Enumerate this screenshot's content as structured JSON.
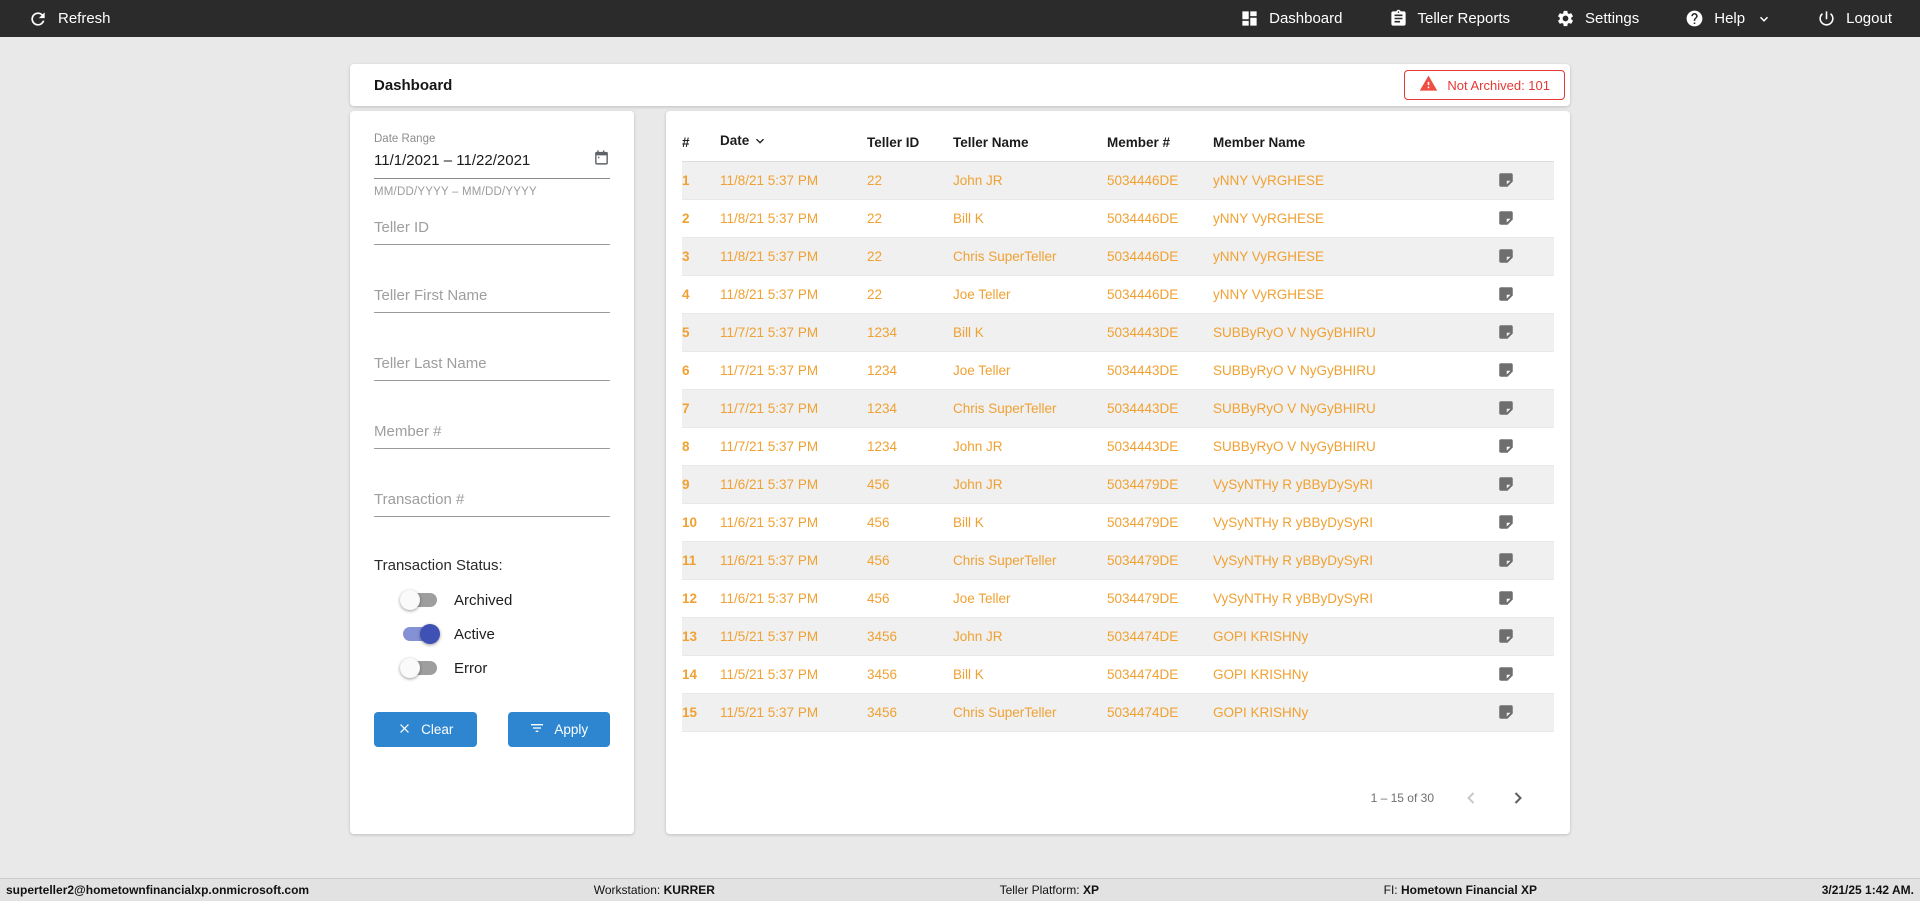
{
  "topbar": {
    "refresh_label": "Refresh",
    "nav": [
      {
        "label": "Dashboard",
        "icon": "dashboard-icon"
      },
      {
        "label": "Teller Reports",
        "icon": "clipboard-icon"
      },
      {
        "label": "Settings",
        "icon": "gear-icon"
      },
      {
        "label": "Help",
        "icon": "help-icon"
      },
      {
        "label": "Logout",
        "icon": "power-icon"
      }
    ]
  },
  "header": {
    "title": "Dashboard",
    "not_archived_badge": "Not Archived: 101"
  },
  "filters": {
    "date_range": {
      "label": "Date Range",
      "value": "11/1/2021 – 11/22/2021",
      "hint": "MM/DD/YYYY – MM/DD/YYYY"
    },
    "fields": [
      {
        "placeholder": "Teller ID"
      },
      {
        "placeholder": "Teller First Name"
      },
      {
        "placeholder": "Teller Last Name"
      },
      {
        "placeholder": "Member #"
      },
      {
        "placeholder": "Transaction #"
      }
    ],
    "status": {
      "label": "Transaction Status:",
      "toggles": [
        {
          "label": "Archived",
          "on": false
        },
        {
          "label": "Active",
          "on": true
        },
        {
          "label": "Error",
          "on": false
        }
      ]
    },
    "clear_label": "Clear",
    "apply_label": "Apply"
  },
  "table": {
    "columns": [
      "#",
      "Date",
      "Teller ID",
      "Teller Name",
      "Member #",
      "Member Name",
      ""
    ],
    "sorted_column": "Date",
    "rows": [
      {
        "num": "1",
        "date": "11/8/21 5:37 PM",
        "teller_id": "22",
        "teller_name": "John JR",
        "member_num": "5034446DE",
        "member_name": "yNNY VyRGHESE"
      },
      {
        "num": "2",
        "date": "11/8/21 5:37 PM",
        "teller_id": "22",
        "teller_name": "Bill K",
        "member_num": "5034446DE",
        "member_name": "yNNY VyRGHESE"
      },
      {
        "num": "3",
        "date": "11/8/21 5:37 PM",
        "teller_id": "22",
        "teller_name": "Chris SuperTeller",
        "member_num": "5034446DE",
        "member_name": "yNNY VyRGHESE"
      },
      {
        "num": "4",
        "date": "11/8/21 5:37 PM",
        "teller_id": "22",
        "teller_name": "Joe Teller",
        "member_num": "5034446DE",
        "member_name": "yNNY VyRGHESE"
      },
      {
        "num": "5",
        "date": "11/7/21 5:37 PM",
        "teller_id": "1234",
        "teller_name": "Bill K",
        "member_num": "5034443DE",
        "member_name": "SUBByRyO V NyGyBHIRU"
      },
      {
        "num": "6",
        "date": "11/7/21 5:37 PM",
        "teller_id": "1234",
        "teller_name": "Joe Teller",
        "member_num": "5034443DE",
        "member_name": "SUBByRyO V NyGyBHIRU"
      },
      {
        "num": "7",
        "date": "11/7/21 5:37 PM",
        "teller_id": "1234",
        "teller_name": "Chris SuperTeller",
        "member_num": "5034443DE",
        "member_name": "SUBByRyO V NyGyBHIRU"
      },
      {
        "num": "8",
        "date": "11/7/21 5:37 PM",
        "teller_id": "1234",
        "teller_name": "John JR",
        "member_num": "5034443DE",
        "member_name": "SUBByRyO V NyGyBHIRU"
      },
      {
        "num": "9",
        "date": "11/6/21 5:37 PM",
        "teller_id": "456",
        "teller_name": "John JR",
        "member_num": "5034479DE",
        "member_name": "VySyNTHy R yBByDySyRI"
      },
      {
        "num": "10",
        "date": "11/6/21 5:37 PM",
        "teller_id": "456",
        "teller_name": "Bill K",
        "member_num": "5034479DE",
        "member_name": "VySyNTHy R yBByDySyRI"
      },
      {
        "num": "11",
        "date": "11/6/21 5:37 PM",
        "teller_id": "456",
        "teller_name": "Chris SuperTeller",
        "member_num": "5034479DE",
        "member_name": "VySyNTHy R yBByDySyRI"
      },
      {
        "num": "12",
        "date": "11/6/21 5:37 PM",
        "teller_id": "456",
        "teller_name": "Joe Teller",
        "member_num": "5034479DE",
        "member_name": "VySyNTHy R yBByDySyRI"
      },
      {
        "num": "13",
        "date": "11/5/21 5:37 PM",
        "teller_id": "3456",
        "teller_name": "John JR",
        "member_num": "5034474DE",
        "member_name": "GOPI KRISHNy"
      },
      {
        "num": "14",
        "date": "11/5/21 5:37 PM",
        "teller_id": "3456",
        "teller_name": "Bill K",
        "member_num": "5034474DE",
        "member_name": "GOPI KRISHNy"
      },
      {
        "num": "15",
        "date": "11/5/21 5:37 PM",
        "teller_id": "3456",
        "teller_name": "Chris SuperTeller",
        "member_num": "5034474DE",
        "member_name": "GOPI KRISHNy"
      }
    ],
    "pagination": {
      "range_label": "1 – 15 of 30"
    }
  },
  "statusbar": {
    "email": "superteller2@hometownfinancialxp.onmicrosoft.com",
    "workstation_label": "Workstation: ",
    "workstation": "KURRER",
    "platform_label": "Teller Platform: ",
    "platform": "XP",
    "fi_label": "FI: ",
    "fi": "Hometown Financial XP",
    "timestamp": "3/21/25 1:42 AM."
  },
  "colors": {
    "topbar_bg": "#2b2b2b",
    "accent_blue": "#2e86d1",
    "row_orange": "#f0a132",
    "badge_red": "#e53935",
    "toggle_on": "#3f51b5",
    "stripe_gray": "#f0f0f0"
  }
}
